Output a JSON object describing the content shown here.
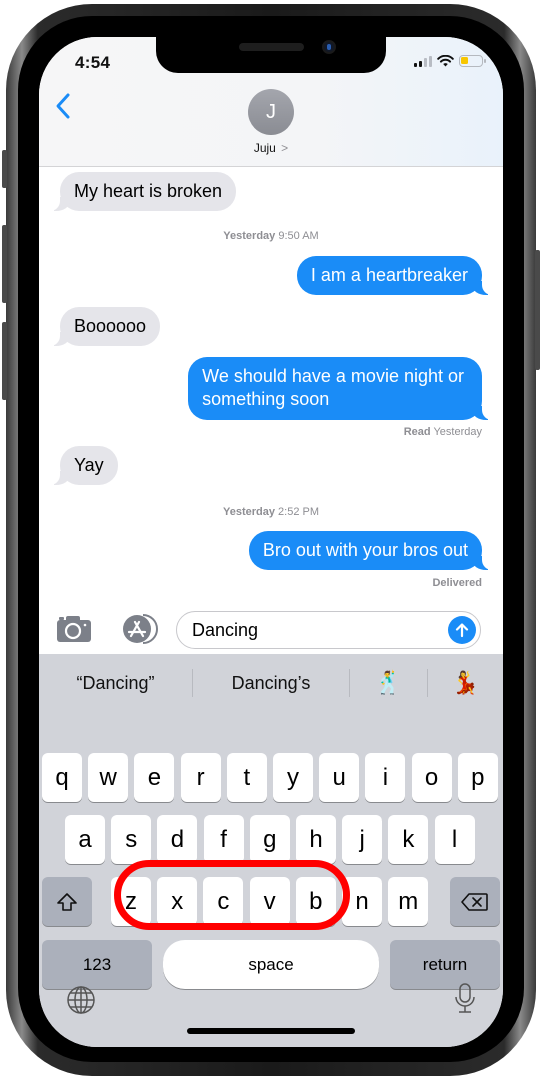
{
  "status_bar": {
    "time": "4:54",
    "signal_bars_active": 2,
    "signal_bars_total": 4,
    "battery_level": 0.35,
    "battery_color": "#f7c600"
  },
  "header": {
    "back_icon": "chevron-left-icon",
    "avatar_initial": "J",
    "contact_name": "Juju",
    "contact_chevron": ">"
  },
  "messages": [
    {
      "type": "incoming",
      "text": "My heart is broken"
    },
    {
      "type": "timestamp",
      "day": "Yesterday",
      "time": "9:50 AM"
    },
    {
      "type": "outgoing",
      "text": "I am a heartbreaker"
    },
    {
      "type": "incoming",
      "text": "Boooooo"
    },
    {
      "type": "outgoing",
      "lines": [
        "We should have a movie night or",
        "something soon"
      ]
    },
    {
      "type": "receipt",
      "label": "Read",
      "value": "Yesterday"
    },
    {
      "type": "incoming",
      "text": "Yay"
    },
    {
      "type": "timestamp",
      "day": "Yesterday",
      "time": "2:52 PM"
    },
    {
      "type": "outgoing",
      "text": "Bro out with your bros out"
    },
    {
      "type": "receipt",
      "label": "Delivered",
      "value": ""
    }
  ],
  "input_bar": {
    "camera_icon": "camera-icon",
    "apps_icon": "app-store-icon",
    "text_value": "Dancing",
    "send_icon": "arrow-up-icon"
  },
  "keyboard": {
    "suggestions": [
      "“Dancing”",
      "Dancing’s",
      "🕺",
      "💃"
    ],
    "row1": [
      "q",
      "w",
      "e",
      "r",
      "t",
      "y",
      "u",
      "i",
      "o",
      "p"
    ],
    "row2": [
      "a",
      "s",
      "d",
      "f",
      "g",
      "h",
      "j",
      "k",
      "l"
    ],
    "row3": [
      "z",
      "x",
      "c",
      "v",
      "b",
      "n",
      "m"
    ],
    "shift_icon": "shift-icon",
    "delete_icon": "delete-icon",
    "numbers_label": "123",
    "space_label": "space",
    "return_label": "return",
    "globe_icon": "globe-icon",
    "mic_icon": "microphone-icon"
  },
  "annotation": {
    "highlight_target": "space",
    "highlight_color": "#ff0000"
  },
  "colors": {
    "accent_blue": "#1a8cf7",
    "incoming_bubble": "#e5e5ea",
    "keyboard_bg": "#d1d3d9"
  }
}
